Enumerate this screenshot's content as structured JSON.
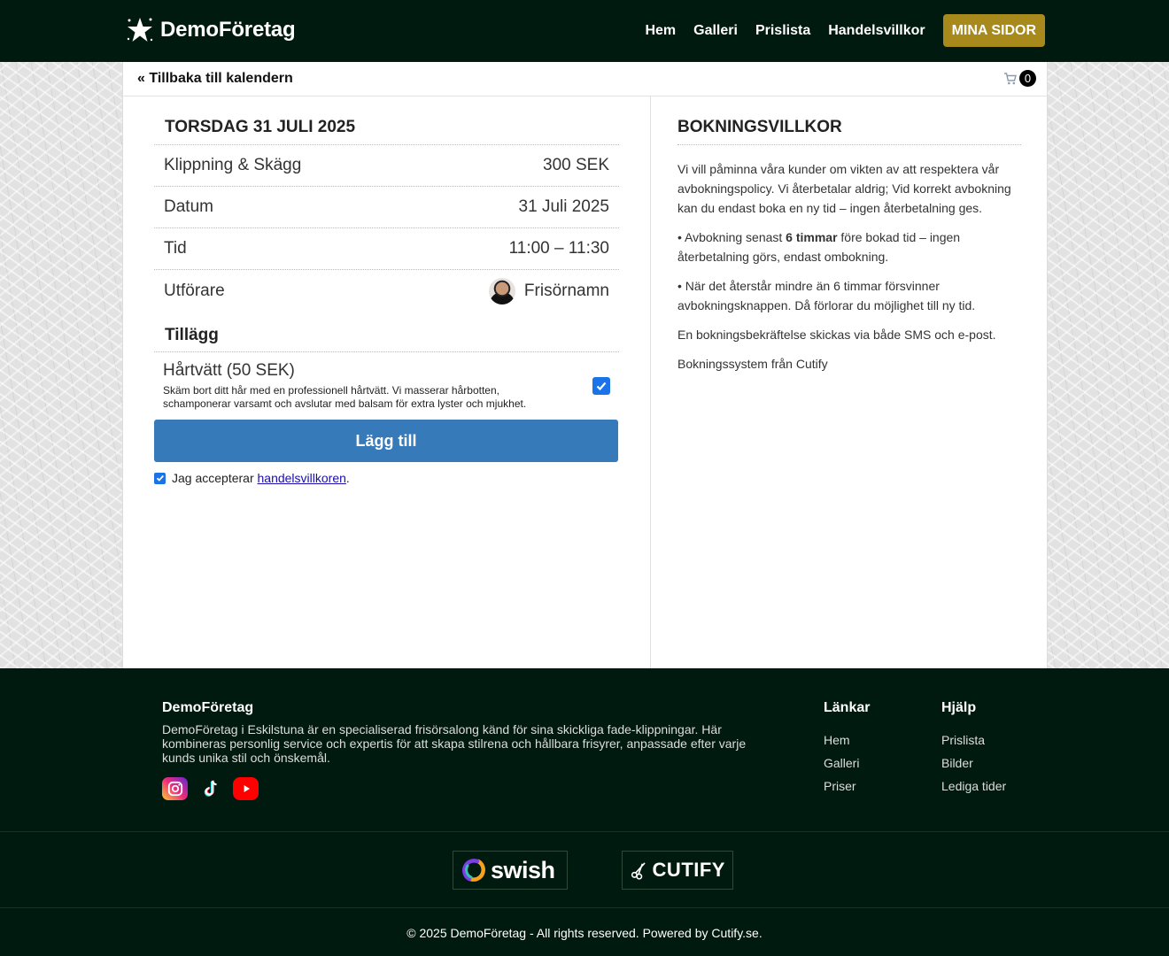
{
  "header": {
    "brand": "DemoFöretag",
    "logo_icon": "star-icon",
    "nav": [
      "Hem",
      "Galleri",
      "Prislista",
      "Handelsvillkor"
    ],
    "cta": "MINA SIDOR",
    "cta_color": "#a8891c"
  },
  "topbar": {
    "back": "« Tillbaka till kalendern",
    "cart_count": "0"
  },
  "booking": {
    "day_title": "TORSDAG 31 JULI 2025",
    "rows": [
      {
        "label": "Klippning & Skägg",
        "value": "300 SEK"
      },
      {
        "label": "Datum",
        "value": "31 Juli 2025"
      },
      {
        "label": "Tid",
        "value": "11:00 – 11:30"
      },
      {
        "label": "Utförare",
        "value": "Frisörnamn"
      }
    ],
    "addons_title": "Tillägg",
    "addon": {
      "name": "Hårtvätt (50 SEK)",
      "description": "Skäm bort ditt hår med en professionell hårtvätt. Vi masserar hårbotten, schamponerar varsamt och avslutar med balsam för extra lyster och mjukhet.",
      "checked": true
    },
    "add_button": "Lägg till",
    "add_button_color": "#377ab9",
    "terms_prefix": "Jag accepterar ",
    "terms_link": "handelsvillkoren",
    "terms_suffix": "."
  },
  "conditions": {
    "title": "BOKNINGSVILLKOR",
    "p1": "Vi vill påminna våra kunder om vikten av att respektera vår avbokningspolicy. Vi återbetalar aldrig; Vid korrekt avbokning kan du endast boka en ny tid – ingen återbetalning ges.",
    "p2_prefix": "• Avbokning senast ",
    "p2_bold": "6 timmar",
    "p2_suffix": " före bokad tid – ingen återbetalning görs, endast ombokning.",
    "p3": "• När det återstår mindre än 6 timmar försvinner avbokningsknappen. Då förlorar du möjlighet till ny tid.",
    "p4": "En bokningsbekräftelse skickas via både SMS och e-post.",
    "p5": "Bokningssystem från Cutify"
  },
  "footer": {
    "brand": "DemoFöretag",
    "description": "DemoFöretag i Eskilstuna är en specialiserad frisörsalong känd för sina skickliga fade-klippningar. Här kombineras personlig service och expertis för att skapa stilrena och hållbara frisyrer, anpassade efter varje kunds unika stil och önskemål.",
    "socials": [
      "instagram-icon",
      "tiktok-icon",
      "youtube-icon"
    ],
    "links_title": "Länkar",
    "links": [
      "Hem",
      "Galleri",
      "Priser"
    ],
    "help_title": "Hjälp",
    "help": [
      "Prislista",
      "Bilder",
      "Lediga tider"
    ],
    "swish": "swish",
    "cutify": "CUTIFY",
    "copyright": "© 2025 DemoFöretag - All rights reserved. Powered by Cutify.se."
  }
}
